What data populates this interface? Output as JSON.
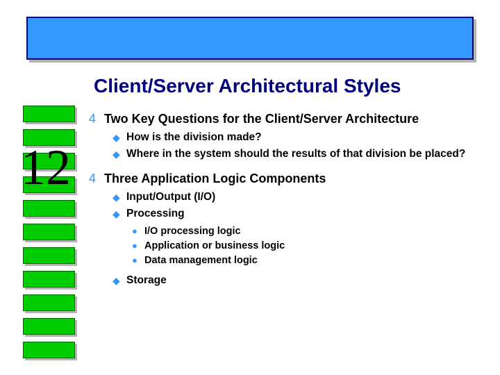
{
  "slide_number": "12",
  "title": "Client/Server Architectural Styles",
  "bullets_l1": {
    "a": "Two Key Questions for the Client/Server Architecture",
    "b": "Three Application Logic Components"
  },
  "bullets_l2": {
    "a1": "How is the division made?",
    "a2": "Where in the system should the results of that division be placed?",
    "b1": "Input/Output (I/O)",
    "b2": "Processing",
    "b3": "Storage"
  },
  "bullets_l3": {
    "p1": "I/O processing logic",
    "p2": "Application or business logic",
    "p3": "Data management logic"
  },
  "glyphs": {
    "l1": "4",
    "l2": "◆",
    "l3": "●"
  },
  "colors": {
    "accent_blue": "#3399ff",
    "title_navy": "#000080",
    "green": "#00cc00"
  }
}
